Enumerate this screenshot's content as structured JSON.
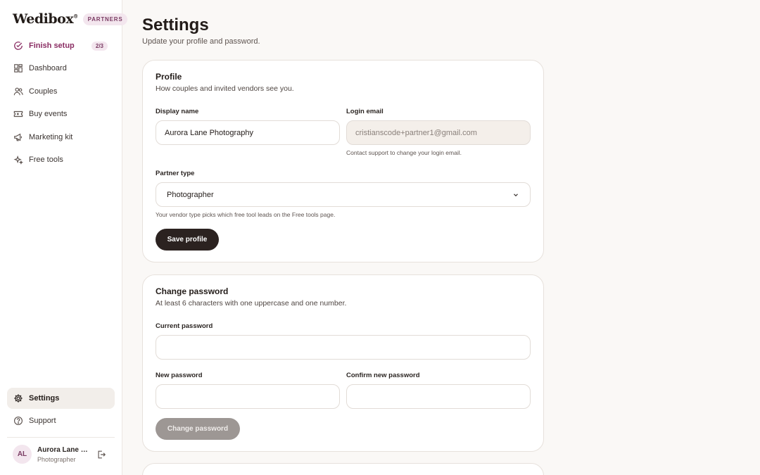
{
  "brand": {
    "logo": "Wedibox",
    "logo_mark": "®",
    "badge": "PARTNERS"
  },
  "sidebar": {
    "items": [
      {
        "label": "Finish setup",
        "icon": "check-circle-icon",
        "count": "2/3"
      },
      {
        "label": "Dashboard",
        "icon": "grid-icon"
      },
      {
        "label": "Couples",
        "icon": "users-icon"
      },
      {
        "label": "Buy events",
        "icon": "ticket-icon"
      },
      {
        "label": "Marketing kit",
        "icon": "megaphone-icon"
      },
      {
        "label": "Free tools",
        "icon": "sparkle-icon"
      }
    ],
    "bottom_items": [
      {
        "label": "Settings",
        "icon": "gear-icon"
      },
      {
        "label": "Support",
        "icon": "help-circle-icon"
      }
    ],
    "user": {
      "initials": "AL",
      "name": "Aurora Lane Photography",
      "role": "Photographer"
    }
  },
  "page": {
    "title": "Settings",
    "subtitle": "Update your profile and password."
  },
  "profile": {
    "title": "Profile",
    "subtitle": "How couples and invited vendors see you.",
    "display_name_label": "Display name",
    "display_name_value": "Aurora Lane Photography",
    "login_email_label": "Login email",
    "login_email_value": "cristianscode+partner1@gmail.com",
    "login_email_hint": "Contact support to change your login email.",
    "partner_type_label": "Partner type",
    "partner_type_value": "Photographer",
    "partner_type_hint": "Your vendor type picks which free tool leads on the Free tools page.",
    "save_label": "Save profile"
  },
  "password": {
    "title": "Change password",
    "subtitle": "At least 6 characters with one uppercase and one number.",
    "current_label": "Current password",
    "new_label": "New password",
    "confirm_label": "Confirm new password",
    "button_label": "Change password"
  },
  "colors": {
    "accent": "#8a2d63",
    "accent_soft": "#f3e6ee",
    "button_dark": "#2b2220",
    "button_disabled": "#9d9794",
    "background": "#faf8f6"
  }
}
